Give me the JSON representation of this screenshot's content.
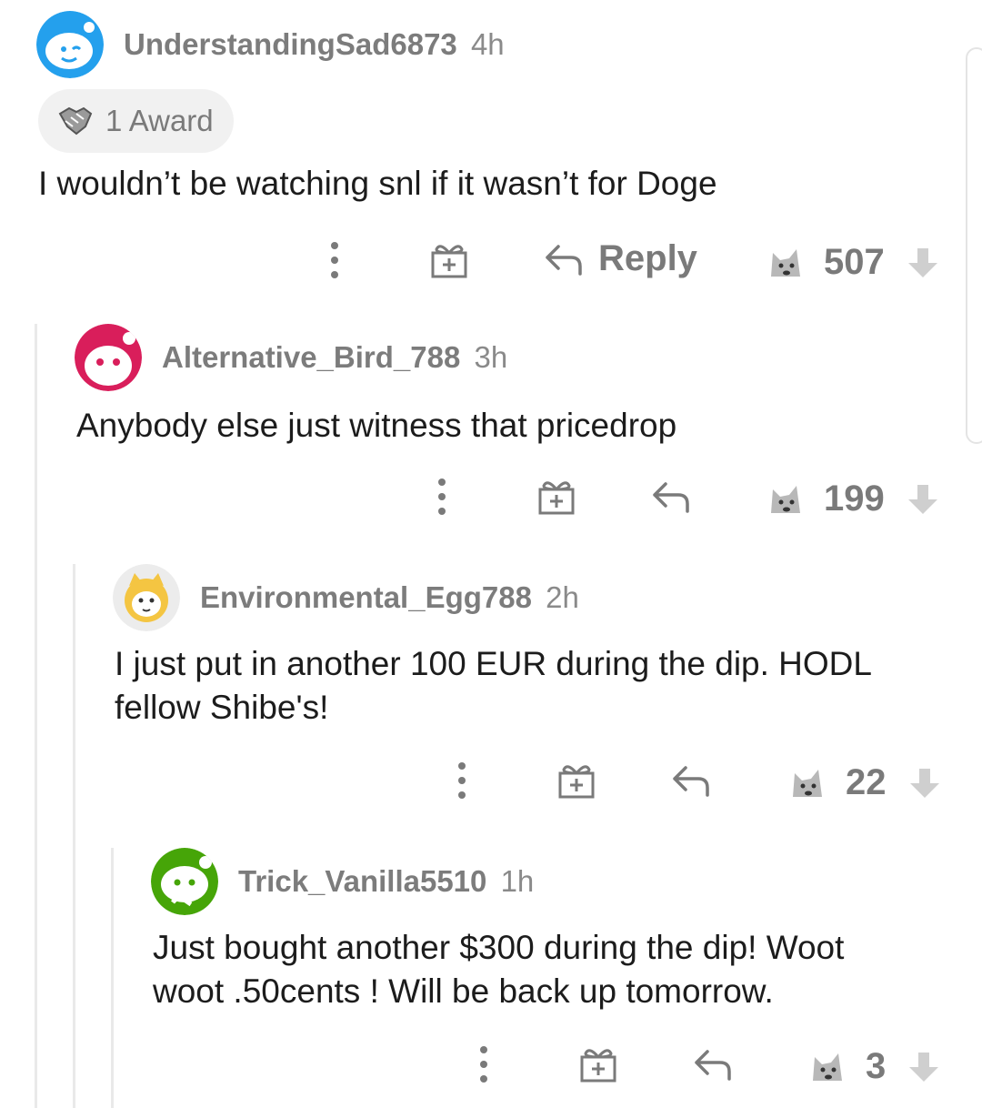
{
  "comments": [
    {
      "username": "UnderstandingSad6873",
      "age": "4h",
      "award_label": "1 Award",
      "body": "I wouldn’t be watching snl if it wasn’t for Doge",
      "reply_label": "Reply",
      "score": "507",
      "avatar_color": "#24a0ed"
    },
    {
      "username": "Alternative_Bird_788",
      "age": "3h",
      "body": "Anybody else just witness that pricedrop",
      "score": "199",
      "avatar_color": "#d91e5b"
    },
    {
      "username": "Environmental_Egg788",
      "age": "2h",
      "body_line1": "I just put in another 100 EUR during the dip. HODL",
      "body_line2": "fellow Shibe's!",
      "score": "22",
      "avatar_color": "#f4c542"
    },
    {
      "username": "Trick_Vanilla5510",
      "age": "1h",
      "body_line1": "Just bought another $300 during the dip! Woot",
      "body_line2": "woot .50cents ! Will be back up tomorrow.",
      "score": "3",
      "avatar_color": "#46a508"
    }
  ],
  "icons": {
    "more": "more-options-icon",
    "gift": "give-award-icon",
    "reply": "reply-arrow-icon",
    "upvote": "doge-upvote-icon",
    "downvote": "downvote-arrow-icon"
  }
}
